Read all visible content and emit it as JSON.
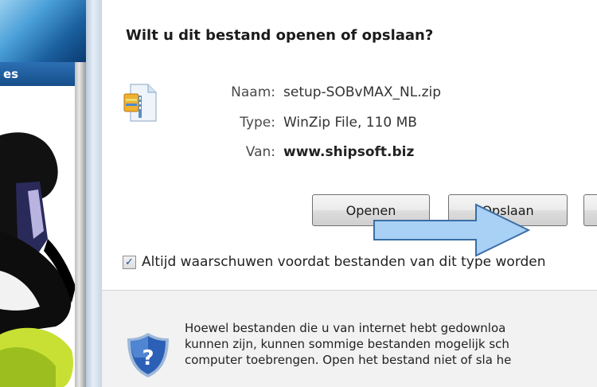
{
  "background": {
    "tab_label": "es"
  },
  "dialog": {
    "title": "Wilt u dit bestand openen of opslaan?",
    "file_icon": "zip-file-icon",
    "fields": [
      {
        "label": "Naam:",
        "value": "setup-SOBvMAX_NL.zip"
      },
      {
        "label": "Type:",
        "value": "WinZip File, 110 MB"
      },
      {
        "label": "Van:",
        "value": "www.shipsoft.biz"
      }
    ],
    "buttons": {
      "open": "Openen",
      "save": "Opslaan",
      "cancel": ""
    },
    "checkbox": {
      "checked": true,
      "label": "Altijd waarschuwen voordat bestanden van dit type worden"
    },
    "warning": {
      "icon": "shield-question-icon",
      "text": "Hoewel bestanden die u van internet hebt gedownloa\nkunnen zijn, kunnen sommige bestanden mogelijk sch\ncomputer toebrengen. Open het bestand niet of sla he"
    }
  },
  "overlay": {
    "arrow_color": "#a9d0f5",
    "arrow_stroke": "#3a6ea5"
  }
}
